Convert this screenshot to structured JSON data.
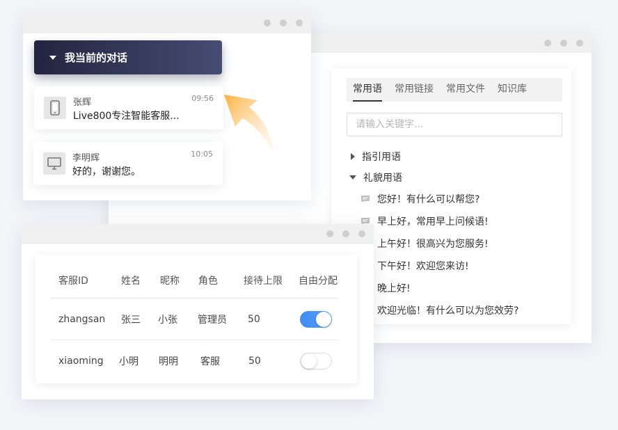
{
  "phrases_window": {
    "tabs": [
      {
        "label": "常用语",
        "active": true
      },
      {
        "label": "常用链接",
        "active": false
      },
      {
        "label": "常用文件",
        "active": false
      },
      {
        "label": "知识库",
        "active": false
      }
    ],
    "search_placeholder": "请输入关键字...",
    "groups": [
      {
        "label": "指引用语",
        "expanded": false
      },
      {
        "label": "礼貌用语",
        "expanded": true
      }
    ],
    "phrases": [
      "您好！有什么可以帮您?",
      "早上好，常用早上问候语!",
      "上午好！很高兴为您服务!",
      "下午好！欢迎您来访!",
      "晚上好!",
      "欢迎光临！有什么可以为您效劳?"
    ]
  },
  "conversation_window": {
    "header_title": "我当前的对话",
    "conversations": [
      {
        "name": "张辉",
        "message": "Live800专注智能客服...",
        "time": "09:56",
        "device": "mobile-phone-icon"
      },
      {
        "name": "李明辉",
        "message": "好的，谢谢您。",
        "time": "10:05",
        "device": "desktop-computer-icon"
      }
    ]
  },
  "agents_window": {
    "columns": [
      "客服ID",
      "姓名",
      "昵称",
      "角色",
      "接待上限",
      "自由分配"
    ],
    "rows": [
      {
        "id": "zhangsan",
        "name": "张三",
        "nickname": "小张",
        "role": "管理员",
        "limit": "50",
        "free_assign": true
      },
      {
        "id": "xiaoming",
        "name": "小明",
        "nickname": "明明",
        "role": "客服",
        "limit": "50",
        "free_assign": false
      }
    ]
  },
  "colors": {
    "header_gradient_start": "#23243f",
    "header_gradient_end": "#464d72",
    "toggle_on": "#3d8cf5",
    "arrow": "#ffb347"
  }
}
